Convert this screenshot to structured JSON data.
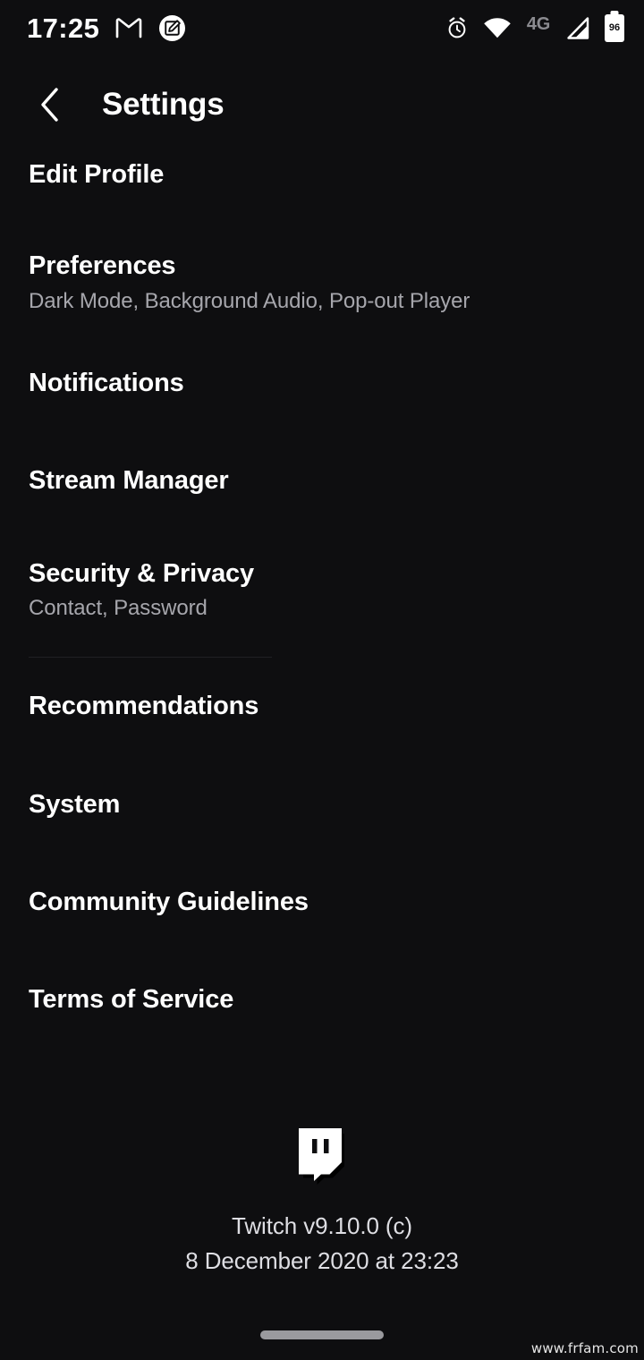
{
  "status_bar": {
    "time": "17:25",
    "battery_level": "96",
    "network_label": "4G",
    "icons": [
      "gmail-icon",
      "screenshot-markup-icon",
      "alarm-icon",
      "wifi-icon",
      "cellular-signal-icon",
      "battery-icon"
    ]
  },
  "header": {
    "back_icon": "chevron-left-icon",
    "title": "Settings"
  },
  "settings": {
    "items": [
      {
        "title": "Edit Profile",
        "subtitle": ""
      },
      {
        "title": "Preferences",
        "subtitle": "Dark Mode, Background Audio, Pop-out Player"
      },
      {
        "title": "Notifications",
        "subtitle": ""
      },
      {
        "title": "Stream Manager",
        "subtitle": ""
      },
      {
        "title": "Security & Privacy",
        "subtitle": "Contact, Password"
      },
      {
        "title": "Recommendations",
        "subtitle": ""
      },
      {
        "title": "System",
        "subtitle": ""
      },
      {
        "title": "Community Guidelines",
        "subtitle": ""
      },
      {
        "title": "Terms of Service",
        "subtitle": ""
      }
    ]
  },
  "footer": {
    "logo": "twitch-logo",
    "version_line": "Twitch v9.10.0 (c)",
    "build_date_line": "8 December 2020 at 23:23"
  },
  "watermark": "www.frfam.com",
  "colors": {
    "background": "#0e0e10",
    "primary_text": "#ffffff",
    "secondary_text": "#a6a6ac",
    "divider": "#202024",
    "muted_label": "#8b8b90"
  }
}
